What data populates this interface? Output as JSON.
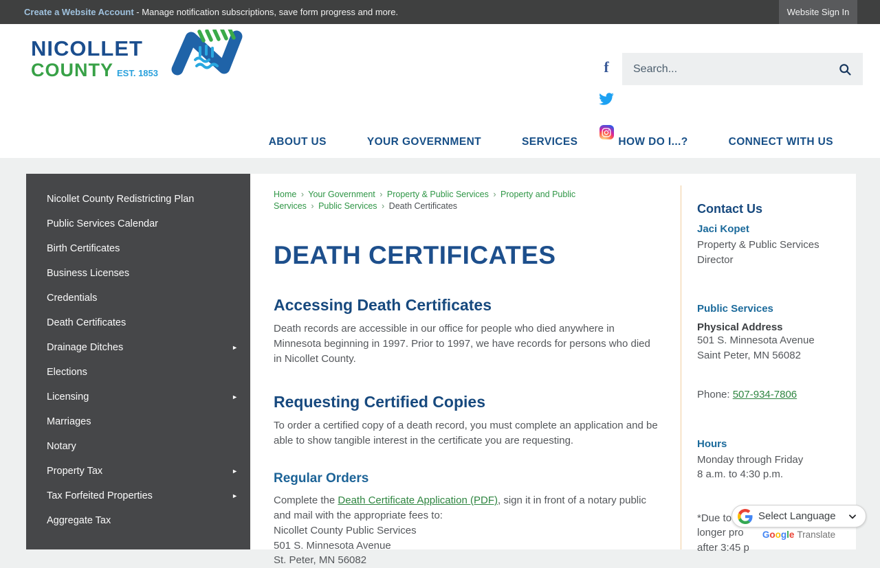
{
  "top_bar": {
    "account_link": "Create a Website Account",
    "account_tagline": " - Manage notification subscriptions, save form progress and more.",
    "sign_in_label": "Website Sign In"
  },
  "header": {
    "logo": {
      "line1": "NICOLLET",
      "line2": "COUNTY",
      "est": "EST. 1853"
    },
    "search": {
      "placeholder": "Search..."
    }
  },
  "nav": {
    "items": [
      {
        "label": "ABOUT US"
      },
      {
        "label": "YOUR GOVERNMENT"
      },
      {
        "label": "SERVICES"
      },
      {
        "label": "HOW DO I...?"
      },
      {
        "label": "CONNECT WITH US"
      }
    ]
  },
  "sidebar": {
    "items": [
      {
        "label": "Nicollet County Redistricting Plan",
        "arrow": ""
      },
      {
        "label": "Public Services Calendar",
        "arrow": ""
      },
      {
        "label": "Birth Certificates",
        "arrow": ""
      },
      {
        "label": "Business Licenses",
        "arrow": ""
      },
      {
        "label": "Credentials",
        "arrow": ""
      },
      {
        "label": "Death Certificates",
        "arrow": ""
      },
      {
        "label": "Drainage Ditches",
        "arrow": "►"
      },
      {
        "label": "Elections",
        "arrow": ""
      },
      {
        "label": "Licensing",
        "arrow": "►"
      },
      {
        "label": "Marriages",
        "arrow": ""
      },
      {
        "label": "Notary",
        "arrow": ""
      },
      {
        "label": "Property Tax",
        "arrow": "►"
      },
      {
        "label": "Tax Forfeited Properties",
        "arrow": "►"
      },
      {
        "label": "Aggregate Tax",
        "arrow": ""
      }
    ]
  },
  "breadcrumb": {
    "separator": "›",
    "links": [
      "Home",
      "Your Government",
      "Property & Public Services",
      "Property and Public Services",
      "Public Services"
    ],
    "current": "Death Certificates"
  },
  "main": {
    "page_title": "DEATH CERTIFICATES",
    "section1_title": "Accessing Death Certificates",
    "section1_body": "Death records are accessible in our office for people who died anywhere in Minnesota beginning in 1997. Prior to 1997, we have records for persons who died in Nicollet County.",
    "section2_title": "Requesting Certified Copies",
    "section2_body": "To order a certified copy of a death record, you must complete an application and be able to show tangible interest in the certificate you are requesting.",
    "section3_title": "Regular Orders",
    "section3_prefix": "Complete the ",
    "section3_link": "Death Certificate Application (PDF)",
    "section3_suffix": ", sign it in front of a notary public and mail with the appropriate fees to:",
    "address_lines": [
      "Nicollet County Public Services",
      "501 S. Minnesota Avenue",
      "St. Peter, MN 56082"
    ]
  },
  "contact": {
    "title": "Contact Us",
    "person_name": "Jaci Kopet",
    "person_role_line1": "Property & Public Services",
    "person_role_line2": "Director",
    "dept_link": "Public Services",
    "physical_address_label": "Physical Address",
    "address_line1": "501 S. Minnesota Avenue",
    "address_line2": "Saint Peter, MN 56082",
    "phone_label": "Phone: ",
    "phone_number": "507-934-7806",
    "hours_title": "Hours",
    "hours_line1": "Monday through Friday",
    "hours_line2": "8 a.m. to 4:30 p.m.",
    "note_line1": "*Due to complexity, we no",
    "note_line2": "longer pro",
    "note_line3": "after 3:45 p"
  },
  "translate": {
    "select_label": "Select Language",
    "google_letters": [
      "G",
      "o",
      "o",
      "g",
      "l",
      "e"
    ],
    "google_colors": [
      "#4285f4",
      "#ea4335",
      "#fbbc05",
      "#4285f4",
      "#34a853",
      "#ea4335"
    ],
    "translate_word": "Translate"
  },
  "colors": {
    "navy": "#1d4f8c",
    "green": "#2f9646",
    "accent_blue": "#1c6397",
    "sidebar_bg": "#464749"
  }
}
